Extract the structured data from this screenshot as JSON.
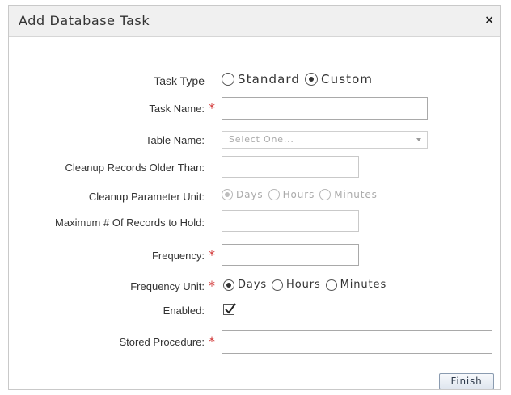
{
  "dialog": {
    "title": "Add Database Task",
    "close_label": "×"
  },
  "form": {
    "task_type": {
      "label": "Task Type",
      "options": [
        {
          "label": "Standard",
          "selected": false
        },
        {
          "label": "Custom",
          "selected": true
        }
      ]
    },
    "task_name": {
      "label": "Task Name:",
      "required_mark": "*",
      "value": ""
    },
    "table_name": {
      "label": "Table Name:",
      "placeholder": "Select One..."
    },
    "cleanup_older_than": {
      "label": "Cleanup Records Older Than:",
      "value": ""
    },
    "cleanup_unit": {
      "label": "Cleanup Parameter Unit:",
      "options": [
        {
          "label": "Days",
          "selected": true
        },
        {
          "label": "Hours",
          "selected": false
        },
        {
          "label": "Minutes",
          "selected": false
        }
      ]
    },
    "max_records": {
      "label": "Maximum # Of Records to Hold:",
      "value": ""
    },
    "frequency": {
      "label": "Frequency:",
      "required_mark": "*",
      "value": ""
    },
    "frequency_unit": {
      "label": "Frequency Unit:",
      "required_mark": "*",
      "options": [
        {
          "label": "Days",
          "selected": true
        },
        {
          "label": "Hours",
          "selected": false
        },
        {
          "label": "Minutes",
          "selected": false
        }
      ]
    },
    "enabled": {
      "label": "Enabled:",
      "checked": true
    },
    "stored_procedure": {
      "label": "Stored Procedure:",
      "required_mark": "*",
      "value": ""
    }
  },
  "footer": {
    "finish_label": "Finish"
  },
  "colors": {
    "required": "#d33c3c",
    "border": "#a9a9a9",
    "titlebar": "#f0f0f0"
  }
}
